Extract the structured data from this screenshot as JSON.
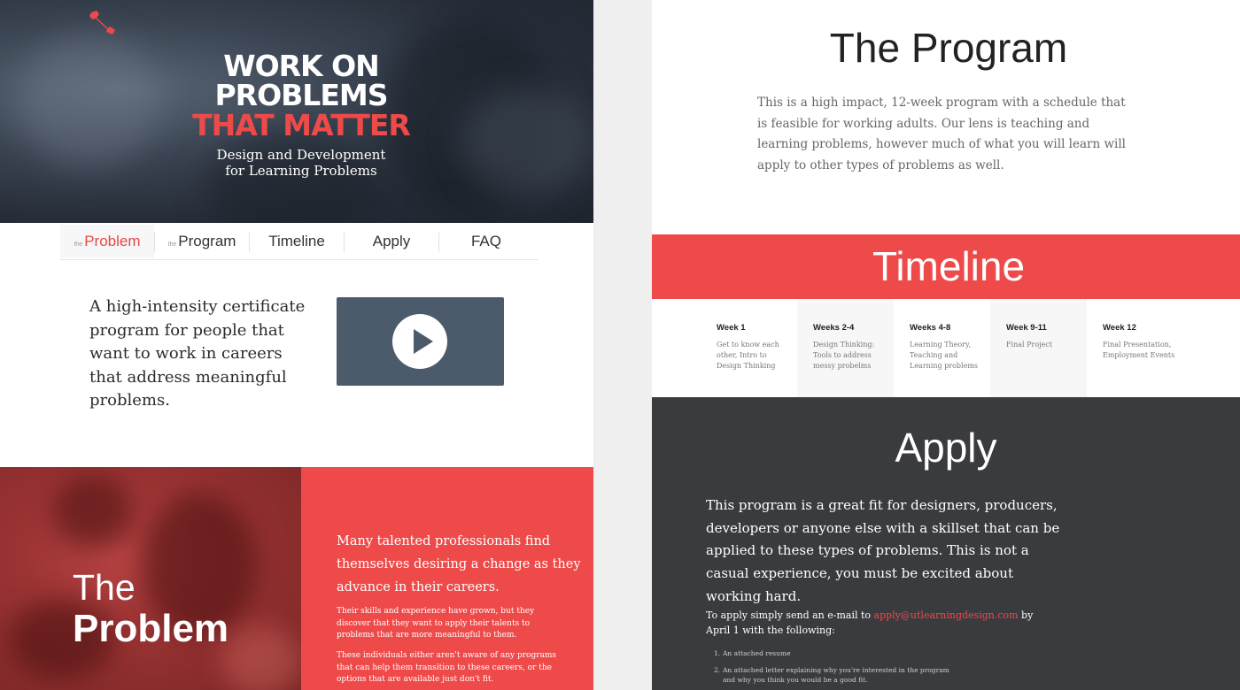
{
  "hero": {
    "title_line1": "WORK ON",
    "title_line2": "PROBLEMS",
    "title_line3": "THAT MATTER",
    "subtitle_line1": "Design and Development",
    "subtitle_line2": "for Learning Problems",
    "logo_icon": "wrench-icon"
  },
  "nav": {
    "items": [
      {
        "prefix": "the",
        "label": "Problem"
      },
      {
        "prefix": "the",
        "label": "Program"
      },
      {
        "label": "Timeline"
      },
      {
        "label": "Apply"
      },
      {
        "label": "FAQ"
      }
    ]
  },
  "intro": {
    "text": "A high-intensity certificate program for people that want to work in careers that address meaningful problems.",
    "video_icon": "play-icon"
  },
  "problem": {
    "title_light": "The",
    "title_bold": "Problem",
    "lead": "Many talented professionals find themselves desiring a change as they advance in their careers.",
    "p1": "Their skills and experience have grown, but they discover that they want to apply their talents to problems that are more meaningful to them.",
    "p2": "These individuals either aren't aware of any programs that can help them transition to these careers, or the options that are available just don't fit."
  },
  "program": {
    "title": "The Program",
    "body": "This is a high impact, 12-week program with a schedule that is feasible for working adults. Our lens is teaching and learning problems, however much of what you will learn will apply to other types of problems as well."
  },
  "timeline": {
    "title": "Timeline",
    "columns": [
      {
        "week": "Week 1",
        "desc": "Get to know each other, Intro to Design Thinking"
      },
      {
        "week": "Weeks 2-4",
        "desc": "Design Thinking: Tools to address messy probelms"
      },
      {
        "week": "Weeks 4-8",
        "desc": "Learning Theory, Teaching and Learning problems"
      },
      {
        "week": "Week 9-11",
        "desc": "Final Project"
      },
      {
        "week": "Week 12",
        "desc": "Final Presentation, Employment Events"
      }
    ]
  },
  "apply": {
    "title": "Apply",
    "lead": "This program is a great fit for designers, producers, developers or anyone else with a skillset that can be applied to these types of problems. This is not a casual experience, you must be excited about working hard.",
    "send_prefix": "To apply simply send an e-mail to ",
    "email": "apply@utlearningdesign.com",
    "send_suffix": " by April 1 with the following:",
    "list": [
      {
        "num": "1.",
        "text": "An attached resume"
      },
      {
        "num": "2.",
        "text": "An attached letter explaining why you're interested in the program and why you think you would be a good fit."
      }
    ]
  },
  "colors": {
    "accent": "#ee4a4a",
    "dark": "#3a3b3f",
    "video": "#4c5b6c"
  }
}
